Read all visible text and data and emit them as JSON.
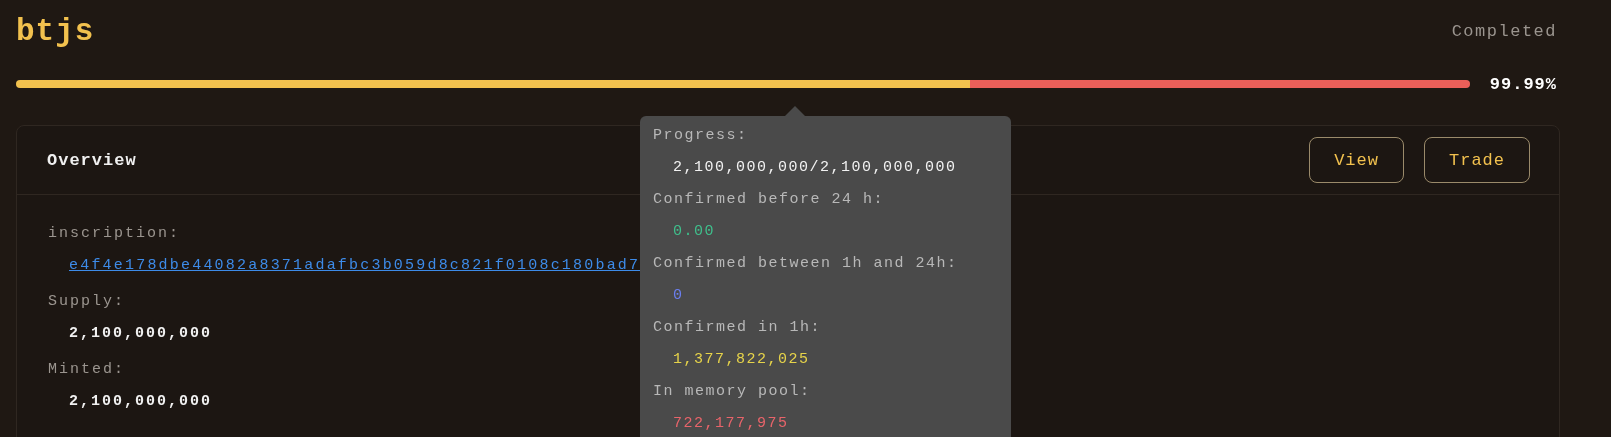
{
  "title": "btjs",
  "status": "Completed",
  "progress": {
    "reading": "99.99%",
    "segments": [
      {
        "level": 0.656,
        "color": "#f2c14e"
      },
      {
        "level": 0.344,
        "color": "#ea5f59"
      }
    ]
  },
  "overview": {
    "title": "Overview",
    "buttons": [
      "View",
      "Trade"
    ],
    "fields": [
      {
        "label": "inscription:",
        "value": "e4f4e178dbe44082a8371adafbc3b059d8c821f0108c180bad7",
        "kind": "link"
      },
      {
        "label": "Supply:",
        "value": "2,100,000,000",
        "kind": "text"
      },
      {
        "label": "Minted:",
        "value": "2,100,000,000",
        "kind": "text"
      }
    ]
  },
  "tooltip": {
    "items": [
      {
        "label": "Progress:",
        "value": "2,100,000,000/2,100,000,000",
        "color": "#f2f2f2"
      },
      {
        "label": "Confirmed before 24 h:",
        "value": "0.00",
        "color": "#3fbf8c"
      },
      {
        "label": "Confirmed between 1h and 24h:",
        "value": "0",
        "color": "#6b7ff0"
      },
      {
        "label": "Confirmed in 1h:",
        "value": "1,377,822,025",
        "color": "#e6d34a"
      },
      {
        "label": "In memory pool:",
        "value": "722,177,975",
        "color": "#e8646a"
      }
    ]
  }
}
